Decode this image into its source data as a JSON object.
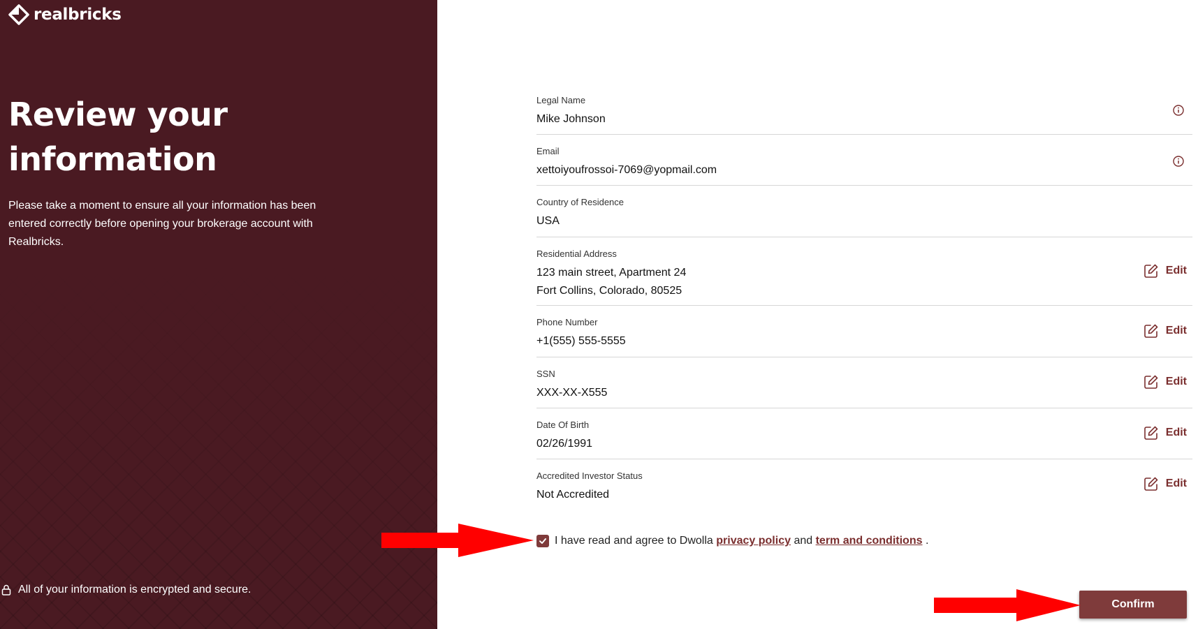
{
  "brand": {
    "name": "realbricks"
  },
  "left": {
    "headline": "Review your information",
    "description": "Please take a moment to ensure all your information has been entered correctly before opening your brokerage account with Realbricks.",
    "secure_note": "All of your information is encrypted and secure."
  },
  "fields": [
    {
      "label": "Legal Name",
      "value": "Mike Johnson",
      "action": "info-icon"
    },
    {
      "label": "Email",
      "value": "xettoiyoufrossoi-7069@yopmail.com",
      "action": "info-icon"
    },
    {
      "label": "Country of Residence",
      "value": "USA",
      "action": "none"
    },
    {
      "label": "Residential Address",
      "value": "123 main street, Apartment 24",
      "value2": "Fort Collins, Colorado, 80525",
      "action": "edit"
    },
    {
      "label": "Phone Number",
      "value": "+1(555) 555-5555",
      "action": "edit"
    },
    {
      "label": "SSN",
      "value": "XXX-XX-X555",
      "action": "edit"
    },
    {
      "label": "Date Of Birth",
      "value": "02/26/1991",
      "action": "edit"
    },
    {
      "label": "Accredited Investor Status",
      "value": "Not Accredited",
      "action": "edit"
    }
  ],
  "edit_label": "Edit",
  "agreement": {
    "checked": true,
    "prefix": "I have read and agree to Dwolla",
    "privacy_link": "privacy policy",
    "middle": "and",
    "terms_link": "term and conditions",
    "suffix": "."
  },
  "confirm_label": "Confirm",
  "colors": {
    "panel": "#4a1a22",
    "accent": "#7f3b3b",
    "arrow": "#ff0000"
  }
}
